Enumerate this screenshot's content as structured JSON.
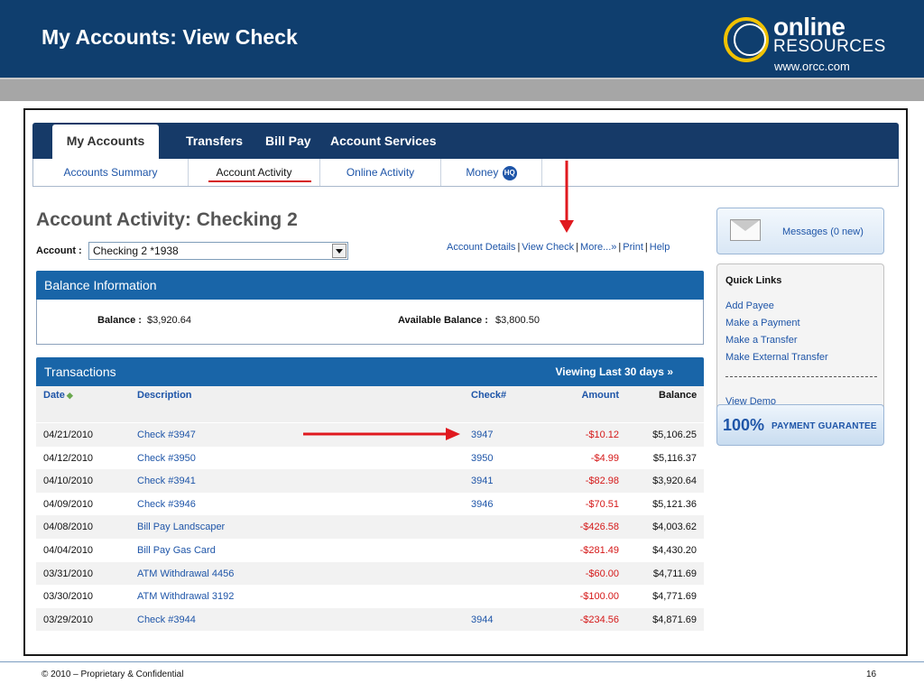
{
  "slide": {
    "title": "My Accounts: View Check",
    "logo_word1": "online",
    "logo_word2": "RESOURCES",
    "logo_url": "www.orcc.com"
  },
  "nav": {
    "tabs": [
      "My Accounts",
      "Transfers",
      "Bill Pay",
      "Account Services"
    ],
    "subtabs": [
      "Accounts Summary",
      "Account Activity",
      "Online Activity",
      "Money"
    ],
    "money_badge": "HQ"
  },
  "page": {
    "heading": "Account Activity: Checking 2",
    "account_label": "Account :",
    "account_selected": "Checking 2 *1938",
    "links": [
      "Account Details",
      "View Check",
      "More...»",
      "Print",
      "Help"
    ]
  },
  "balance": {
    "header": "Balance Information",
    "balance_label": "Balance :",
    "balance_value": "$3,920.64",
    "available_label": "Available Balance :",
    "available_value": "$3,800.50"
  },
  "transactions": {
    "header": "Transactions",
    "viewing": "Viewing Last 30 days »",
    "columns": {
      "date": "Date",
      "description": "Description",
      "check": "Check#",
      "amount": "Amount",
      "balance": "Balance"
    },
    "sort_glyph": "◆",
    "rows": [
      {
        "date": "04/21/2010",
        "description": "Check #3947",
        "check": "3947",
        "amount": "-$10.12",
        "balance": "$5,106.25"
      },
      {
        "date": "04/12/2010",
        "description": "Check #3950",
        "check": "3950",
        "amount": "-$4.99",
        "balance": "$5,116.37"
      },
      {
        "date": "04/10/2010",
        "description": "Check #3941",
        "check": "3941",
        "amount": "-$82.98",
        "balance": "$3,920.64"
      },
      {
        "date": "04/09/2010",
        "description": "Check #3946",
        "check": "3946",
        "amount": "-$70.51",
        "balance": "$5,121.36"
      },
      {
        "date": "04/08/2010",
        "description": "Bill Pay Landscaper",
        "check": "",
        "amount": "-$426.58",
        "balance": "$4,003.62"
      },
      {
        "date": "04/04/2010",
        "description": "Bill Pay Gas Card",
        "check": "",
        "amount": "-$281.49",
        "balance": "$4,430.20"
      },
      {
        "date": "03/31/2010",
        "description": "ATM Withdrawal 4456",
        "check": "",
        "amount": "-$60.00",
        "balance": "$4,711.69"
      },
      {
        "date": "03/30/2010",
        "description": "ATM Withdrawal 3192",
        "check": "",
        "amount": "-$100.00",
        "balance": "$4,771.69"
      },
      {
        "date": "03/29/2010",
        "description": "Check #3944",
        "check": "3944",
        "amount": "-$234.56",
        "balance": "$4,871.69"
      }
    ]
  },
  "sidebar": {
    "messages": "Messages (0 new)",
    "quick_links_title": "Quick Links",
    "quick_links": [
      "Add Payee",
      "Make a Payment",
      "Make a Transfer",
      "Make External Transfer"
    ],
    "view_demo": "View Demo",
    "guarantee_percent": "100%",
    "guarantee_text": "PAYMENT GUARANTEE"
  },
  "footer": {
    "copyright": "© 2010 – Proprietary & Confidential",
    "page_number": "16"
  },
  "colors": {
    "header_navy": "#0f3e6e",
    "nav_navy": "#163a68",
    "panel_blue": "#1965a8",
    "link_blue": "#1e55a8",
    "debit_red": "#d51818",
    "annotation_red": "#e0191f"
  }
}
